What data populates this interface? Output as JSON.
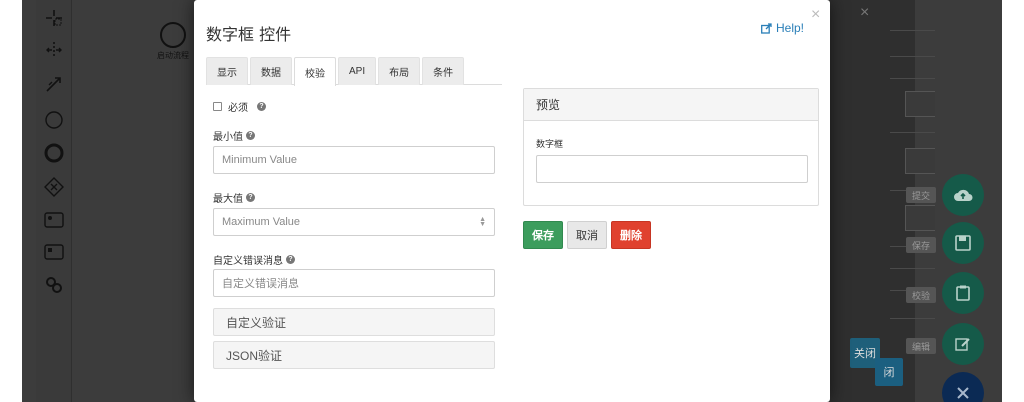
{
  "canvas": {
    "start_event_label": "启动流程"
  },
  "background_panel": {
    "close_label": "×",
    "close_button_label": "关闭",
    "close_button_label2": "闭",
    "fab_labels": [
      "提交",
      "保存",
      "校验",
      "编辑"
    ]
  },
  "modal": {
    "title": "数字框 控件",
    "help_label": "Help!",
    "close_label": "×",
    "tabs": [
      {
        "label": "显示"
      },
      {
        "label": "数据"
      },
      {
        "label": "校验"
      },
      {
        "label": "API"
      },
      {
        "label": "布局"
      },
      {
        "label": "条件"
      }
    ],
    "active_tab": "校验",
    "required_label": "必须",
    "min_label": "最小值",
    "min_placeholder": "Minimum Value",
    "max_label": "最大值",
    "max_placeholder": "Maximum Value",
    "error_label": "自定义错误消息",
    "error_placeholder": "自定义错误消息",
    "custom_validation_label": "自定义验证",
    "json_validation_label": "JSON验证",
    "preview": {
      "title": "预览",
      "field_label": "数字框",
      "field_value": ""
    },
    "buttons": {
      "save": "保存",
      "cancel": "取消",
      "delete": "删除"
    }
  },
  "colors": {
    "save": "#3c9d5d",
    "delete": "#e0412e",
    "link": "#2a7fb8"
  }
}
